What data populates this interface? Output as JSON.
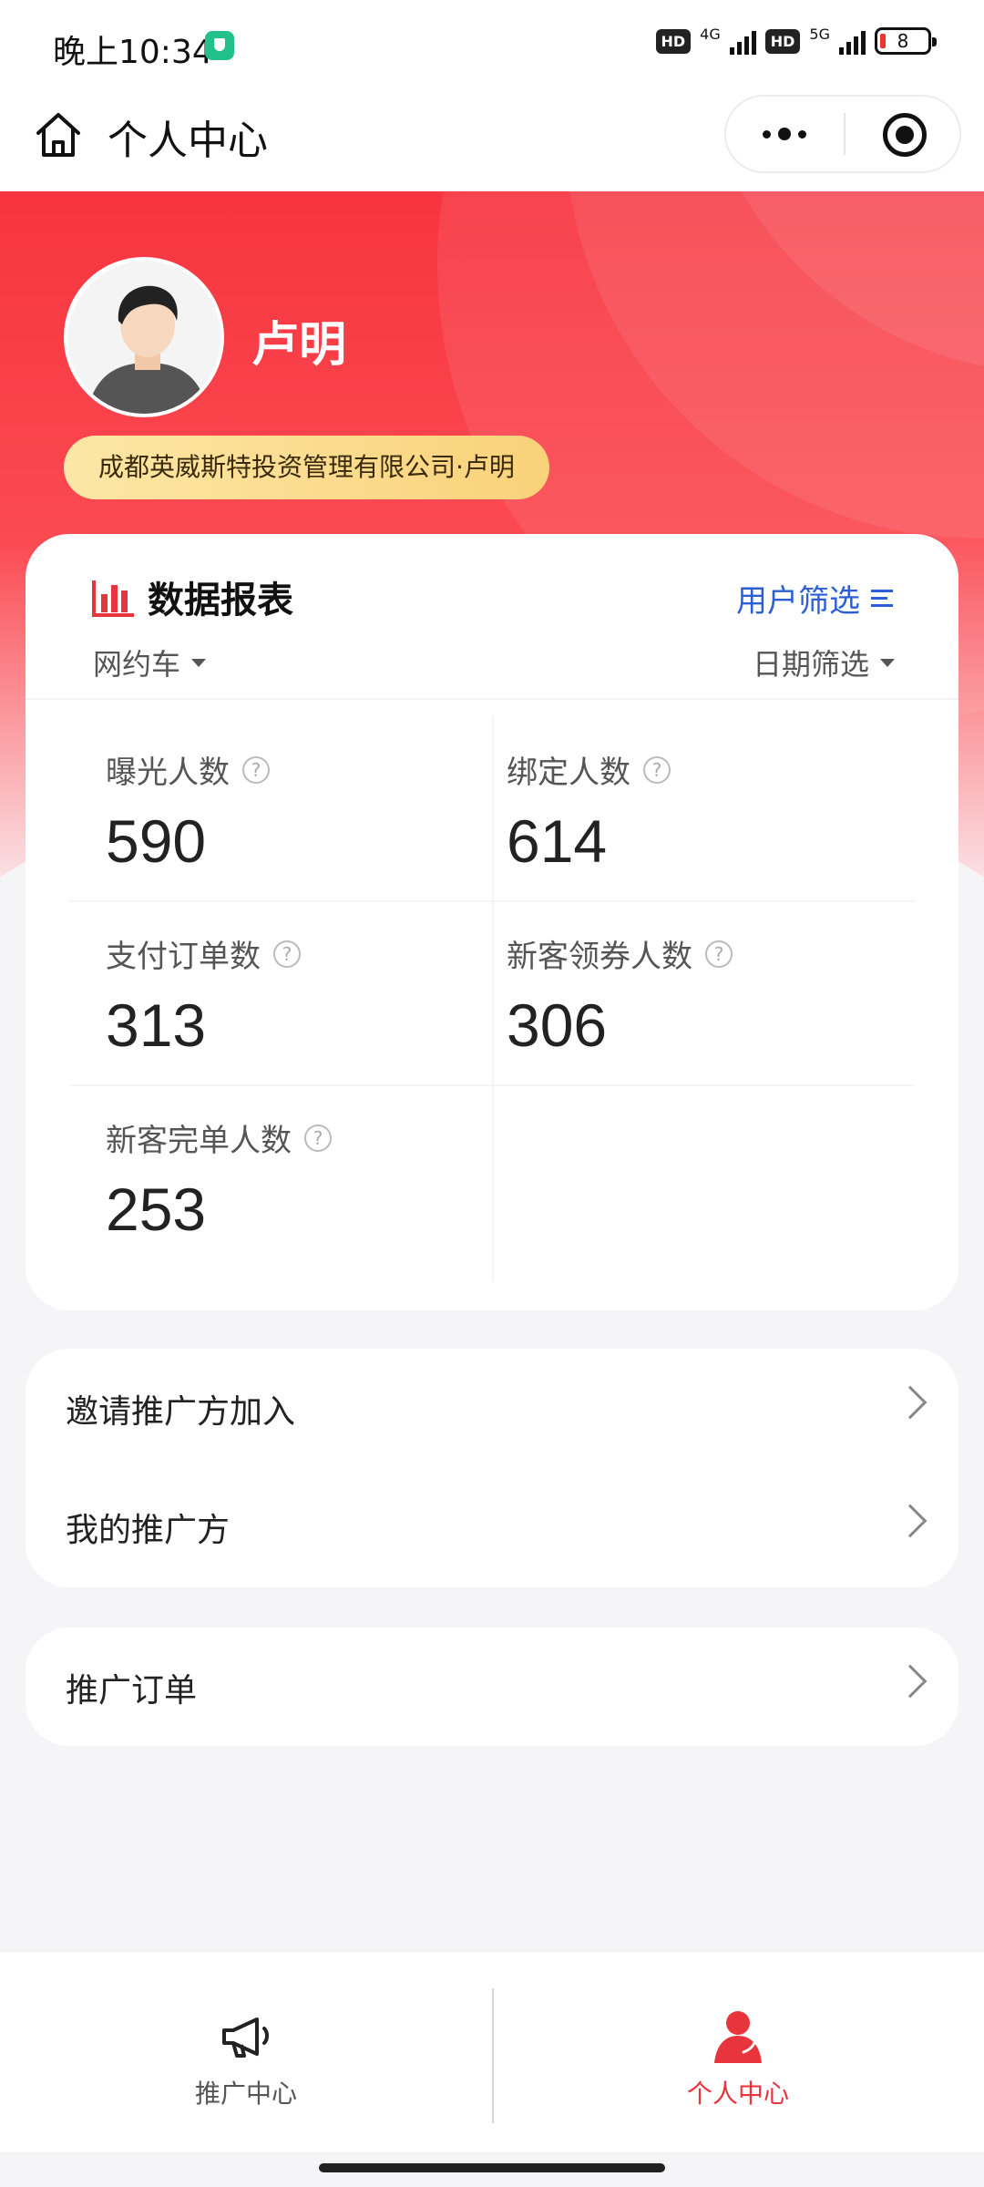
{
  "status_bar": {
    "time": "晚上10:34",
    "hd1": "HD",
    "net1": "4G",
    "hd2": "HD",
    "net2": "5G",
    "battery": "8"
  },
  "nav": {
    "title": "个人中心",
    "icons": [
      "home-icon",
      "more-icon",
      "close-icon"
    ]
  },
  "profile": {
    "name": "卢明",
    "company": "成都英威斯特投资管理有限公司·卢明"
  },
  "data_card": {
    "title": "数据报表",
    "user_filter": "用户筛选",
    "category": "网约车",
    "date_filter": "日期筛选",
    "metrics": [
      {
        "label": "曝光人数",
        "value": "590"
      },
      {
        "label": "绑定人数",
        "value": "614"
      },
      {
        "label": "支付订单数",
        "value": "313"
      },
      {
        "label": "新客领券人数",
        "value": "306"
      },
      {
        "label": "新客完单人数",
        "value": "253"
      }
    ]
  },
  "menu": {
    "invite": "邀请推广方加入",
    "my_promoters": "我的推广方",
    "orders": "推广订单"
  },
  "tab_bar": {
    "tabs": [
      {
        "label": "推广中心",
        "icon": "megaphone-icon",
        "active": false
      },
      {
        "label": "个人中心",
        "icon": "person-icon",
        "active": true
      }
    ],
    "active_color": "#e8343c"
  },
  "colors": {
    "accent": "#f7343f",
    "link": "#2c5fd6"
  }
}
